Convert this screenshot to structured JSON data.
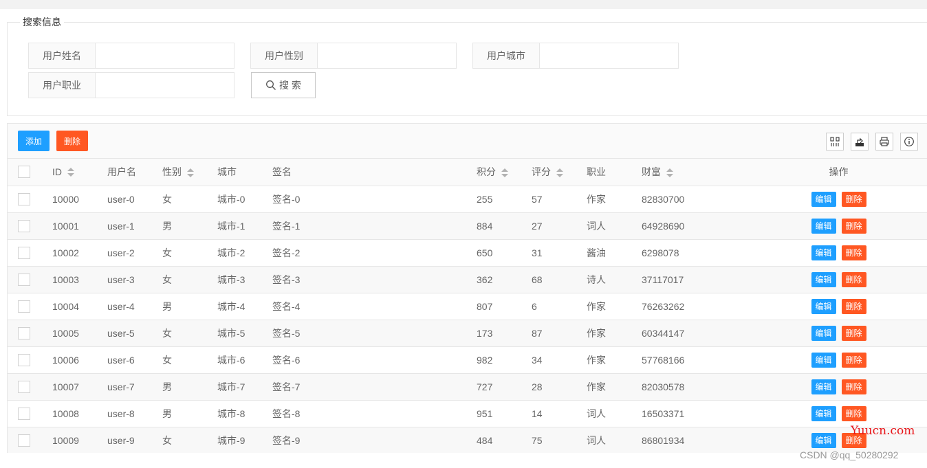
{
  "search": {
    "legend": "搜索信息",
    "fields": [
      {
        "label": "用户姓名",
        "value": ""
      },
      {
        "label": "用户性别",
        "value": ""
      },
      {
        "label": "用户城市",
        "value": ""
      },
      {
        "label": "用户职业",
        "value": ""
      }
    ],
    "button_label": "搜 索"
  },
  "toolbar": {
    "add_label": "添加",
    "delete_label": "删除",
    "icons": [
      "columns-filter-icon",
      "export-icon",
      "print-icon",
      "info-icon"
    ]
  },
  "table": {
    "columns": [
      "ID",
      "用户名",
      "性别",
      "城市",
      "签名",
      "积分",
      "评分",
      "职业",
      "财富",
      "操作"
    ],
    "edit_label": "编辑",
    "delete_label": "删除",
    "rows": [
      [
        "10000",
        "user-0",
        "女",
        "城市-0",
        "签名-0",
        "255",
        "57",
        "作家",
        "82830700"
      ],
      [
        "10001",
        "user-1",
        "男",
        "城市-1",
        "签名-1",
        "884",
        "27",
        "词人",
        "64928690"
      ],
      [
        "10002",
        "user-2",
        "女",
        "城市-2",
        "签名-2",
        "650",
        "31",
        "酱油",
        "6298078"
      ],
      [
        "10003",
        "user-3",
        "女",
        "城市-3",
        "签名-3",
        "362",
        "68",
        "诗人",
        "37117017"
      ],
      [
        "10004",
        "user-4",
        "男",
        "城市-4",
        "签名-4",
        "807",
        "6",
        "作家",
        "76263262"
      ],
      [
        "10005",
        "user-5",
        "女",
        "城市-5",
        "签名-5",
        "173",
        "87",
        "作家",
        "60344147"
      ],
      [
        "10006",
        "user-6",
        "女",
        "城市-6",
        "签名-6",
        "982",
        "34",
        "作家",
        "57768166"
      ],
      [
        "10007",
        "user-7",
        "男",
        "城市-7",
        "签名-7",
        "727",
        "28",
        "作家",
        "82030578"
      ],
      [
        "10008",
        "user-8",
        "男",
        "城市-8",
        "签名-8",
        "951",
        "14",
        "词人",
        "16503371"
      ],
      [
        "10009",
        "user-9",
        "女",
        "城市-9",
        "签名-9",
        "484",
        "75",
        "词人",
        "86801934"
      ]
    ]
  },
  "watermark": {
    "site": "Yuucn.com",
    "author": "CSDN @qq_50280292"
  }
}
